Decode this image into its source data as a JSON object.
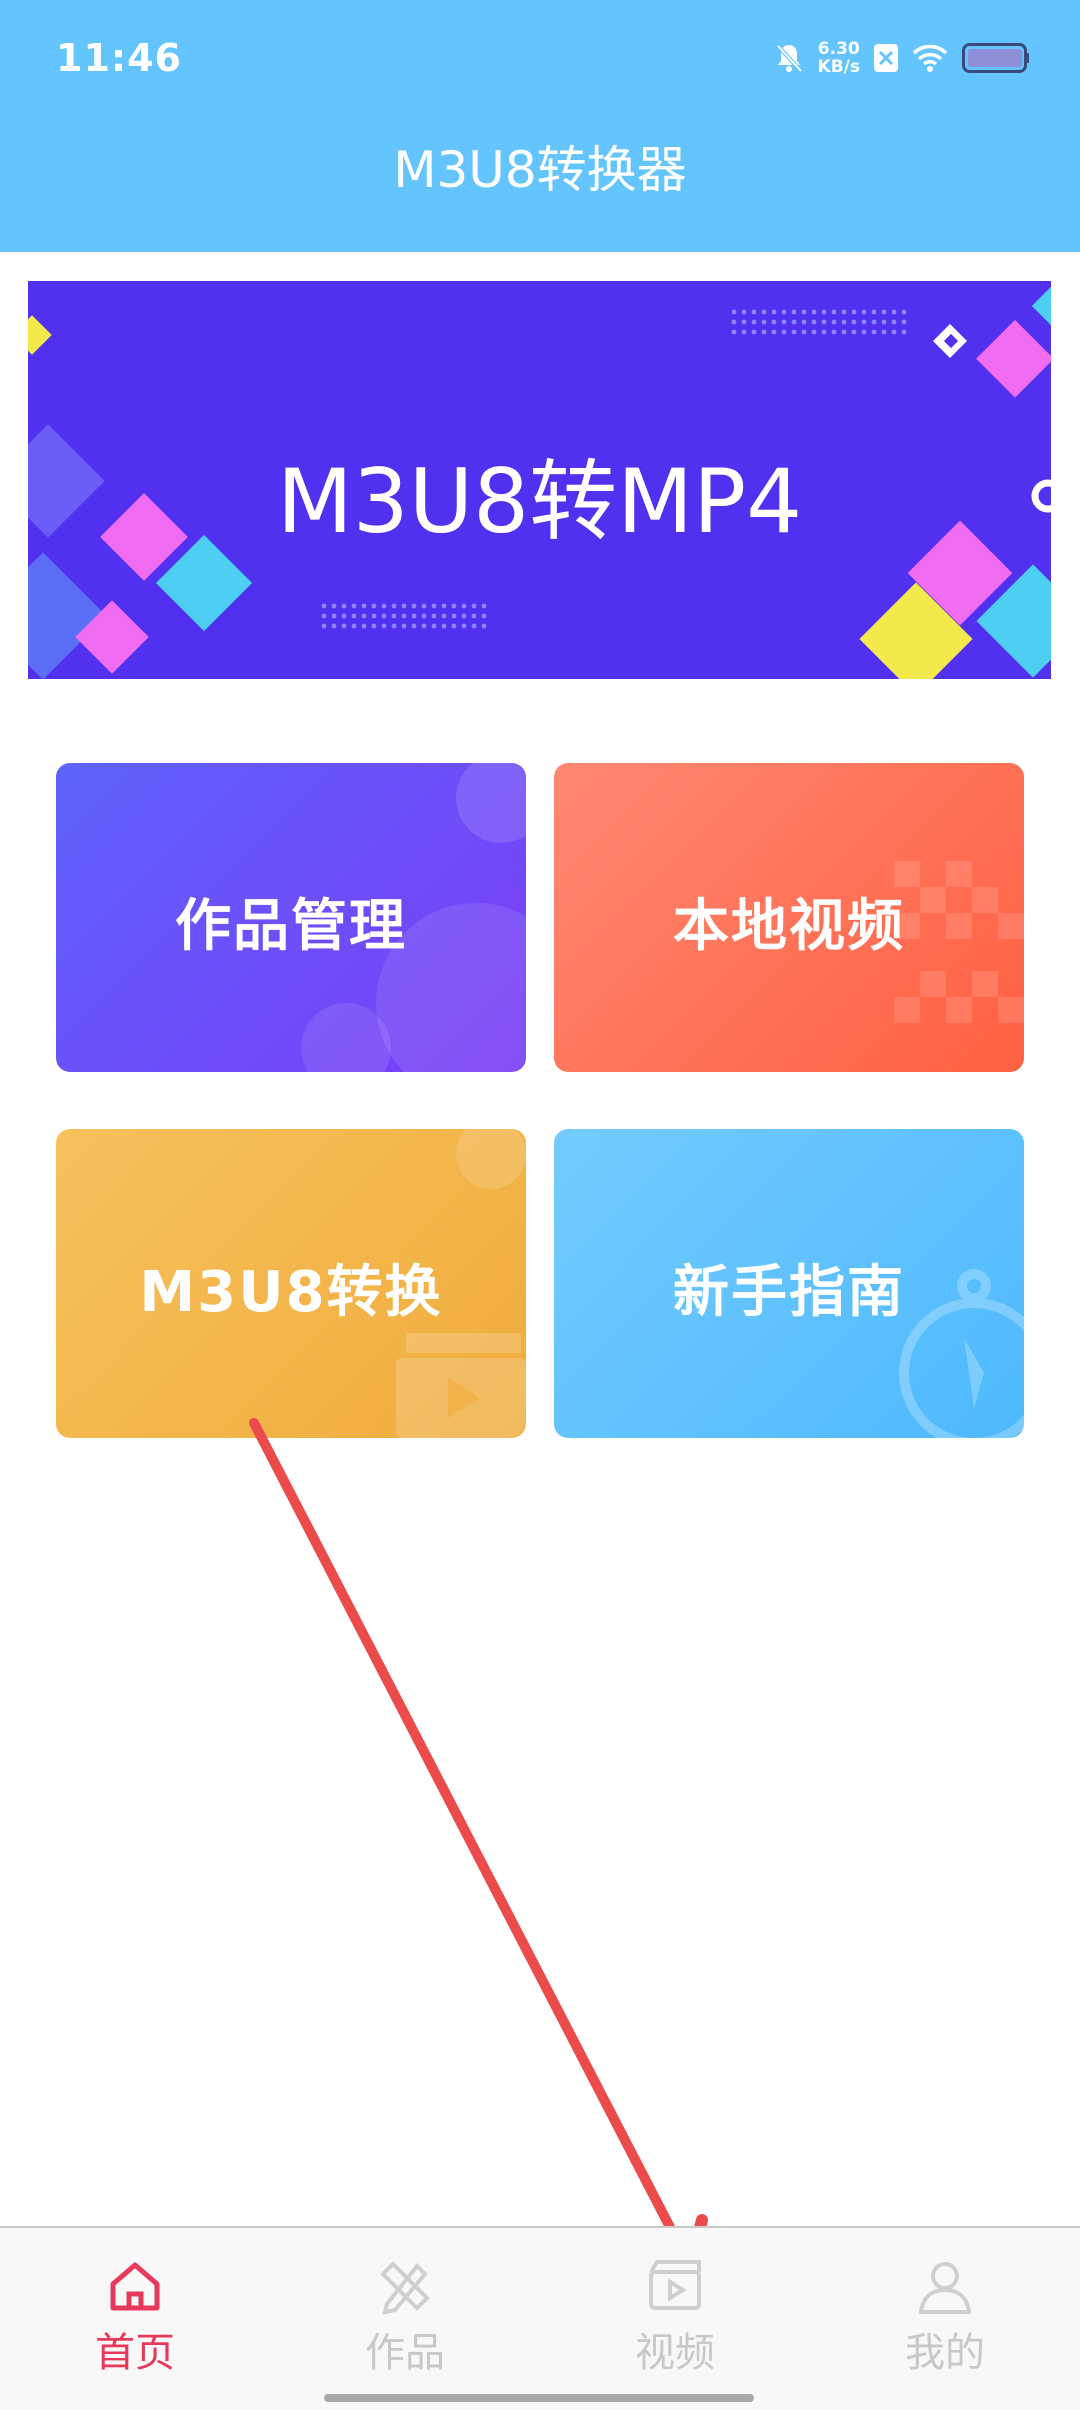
{
  "status_bar": {
    "time": "11:46",
    "net_speed_value": "6.30",
    "net_speed_unit": "KB/s",
    "icons": [
      "bell-muted-icon",
      "x-badge-icon",
      "wifi-icon",
      "battery-icon"
    ]
  },
  "header": {
    "title": "M3U8转换器"
  },
  "banner": {
    "text": "M3U8转MP4"
  },
  "tiles": [
    {
      "label": "作品管理"
    },
    {
      "label": "本地视频"
    },
    {
      "label": "M3U8转换"
    },
    {
      "label": "新手指南"
    }
  ],
  "tab_bar": {
    "items": [
      {
        "label": "首页",
        "icon": "home-icon",
        "active": true
      },
      {
        "label": "作品",
        "icon": "pencil-ruler-icon",
        "active": false
      },
      {
        "label": "视频",
        "icon": "video-icon",
        "active": false
      },
      {
        "label": "我的",
        "icon": "user-icon",
        "active": false
      }
    ]
  },
  "colors": {
    "header": "#64c4fe",
    "banner": "#5131ef",
    "accent": "#e6395b",
    "annotation_arrow": "#eb4b4b"
  }
}
